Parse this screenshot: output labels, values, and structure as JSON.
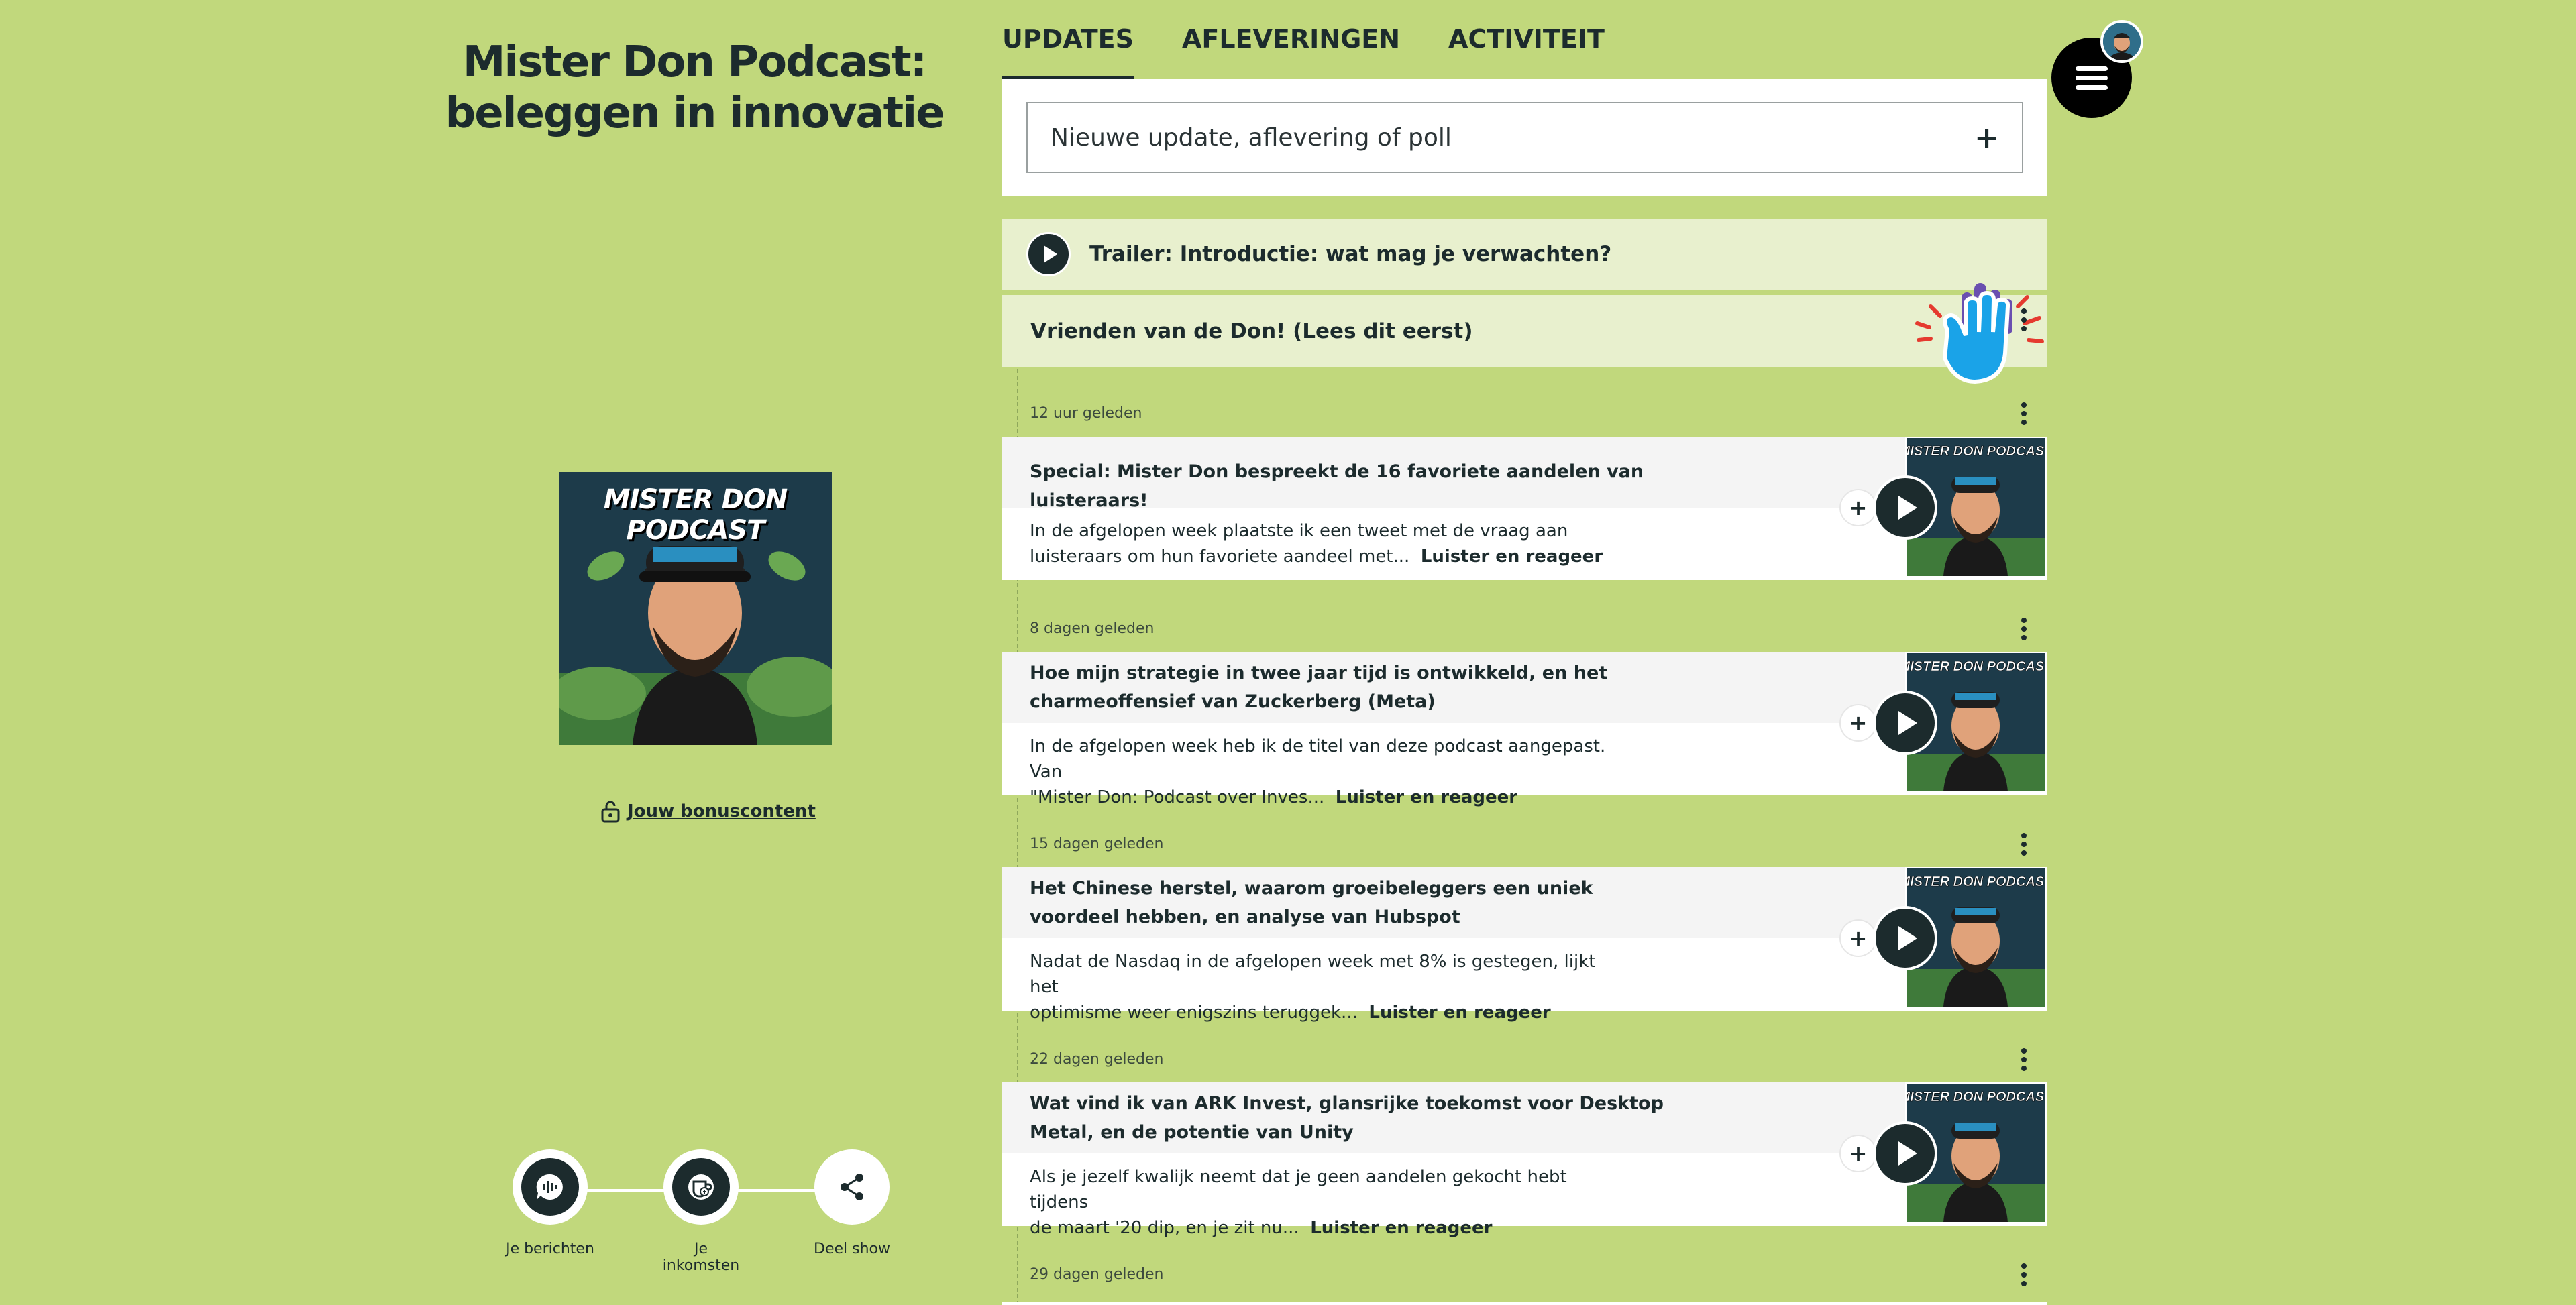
{
  "show": {
    "title_line1": "Mister Don Podcast:",
    "title_line2": "beleggen in innovatie",
    "cover_text": "MISTER DON PODCAST",
    "bonus_label": "Jouw bonuscontent"
  },
  "actions": [
    {
      "label": "Je berichten",
      "icon": "chat-wave-icon"
    },
    {
      "label": "Je inkomsten",
      "icon": "income-icon"
    },
    {
      "label": "Deel show",
      "icon": "share-icon"
    }
  ],
  "tabs": [
    {
      "label": "UPDATES",
      "active": true
    },
    {
      "label": "AFLEVERINGEN",
      "active": false
    },
    {
      "label": "ACTIVITEIT",
      "active": false
    }
  ],
  "composer": {
    "placeholder": "Nieuwe update, aflevering of poll",
    "add_icon": "+"
  },
  "pinned": {
    "trailer": "Trailer: Introductie: wat mag je verwachten?",
    "friends": "Vrienden van de Don! (Lees dit eerst)"
  },
  "episodes": [
    {
      "time": "12 uur geleden",
      "title": "Special: Mister Don bespreekt de 16 favoriete aandelen van luisteraars!",
      "desc_line1": "In de afgelopen week plaatste ik een tweet met de vraag aan",
      "desc_line2": "luisteraars om hun favoriete aandeel met...",
      "cta": "Luister en reageer"
    },
    {
      "time": "8 dagen geleden",
      "title": "Hoe mijn strategie in twee jaar tijd is ontwikkeld, en het charmeoffensief van Zuckerberg (Meta)",
      "desc_line1": "In de afgelopen week heb ik de titel van deze podcast aangepast. Van",
      "desc_line2": "\"Mister Don: Podcast over Inves...",
      "cta": "Luister en reageer"
    },
    {
      "time": "15 dagen geleden",
      "title": "Het Chinese herstel, waarom groeibeleggers een uniek voordeel hebben, en analyse van Hubspot",
      "desc_line1": "Nadat de Nasdaq in de afgelopen week met 8% is gestegen, lijkt het",
      "desc_line2": "optimisme weer enigszins teruggek...",
      "cta": "Luister en reageer"
    },
    {
      "time": "22 dagen geleden",
      "title": "Wat vind ik van ARK Invest, glansrijke toekomst voor Desktop Metal, en de potentie van Unity",
      "desc_line1": "Als je jezelf kwalijk neemt dat je geen aandelen gekocht hebt tijdens",
      "desc_line2": "de maart '20 dip, en je zit nu...",
      "cta": "Luister en reageer"
    },
    {
      "time": "29 dagen geleden"
    }
  ],
  "colors": {
    "background": "#c1d87c",
    "pinned_bg": "#e8f0ce",
    "dark": "#1c2b2d"
  }
}
